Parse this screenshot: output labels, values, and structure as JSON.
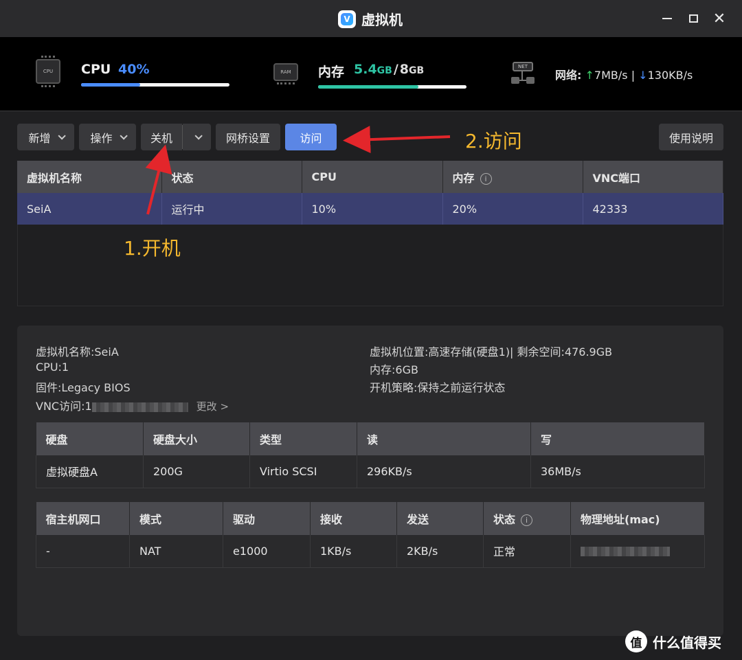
{
  "window": {
    "title": "虚拟机",
    "logo_letter": "V",
    "min_label": "",
    "close_label": "✕"
  },
  "monitor": {
    "cpu": {
      "icon": "CPU",
      "label": "CPU",
      "value": "40%",
      "percent": 40,
      "color": "#4a8dff"
    },
    "ram": {
      "icon": "RAM",
      "label": "内存",
      "used": "5.4",
      "used_unit": "GB",
      "sep": "/",
      "total": "8",
      "total_unit": "GB",
      "percent": 67.5,
      "color": "#2ec4a4"
    },
    "net": {
      "icon": "NET",
      "label": "网络:",
      "up_arrow": "↑",
      "up": "7MB/s",
      "sep": "|",
      "down_arrow": "↓",
      "down": "130KB/s"
    }
  },
  "toolbar": {
    "add": "新增",
    "action": "操作",
    "shutdown": "关机",
    "bridge": "网桥设置",
    "access": "访问",
    "help": "使用说明"
  },
  "vm_table": {
    "headers": [
      "虚拟机名称",
      "状态",
      "CPU",
      "内存",
      "VNC端口"
    ],
    "info_icon": "i",
    "rows": [
      [
        "SeiA",
        "运行中",
        "10%",
        "20%",
        "42333"
      ]
    ]
  },
  "annotations": {
    "a1": "1.开机",
    "a2": "2.访问"
  },
  "detail": {
    "name": "虚拟机名称:SeiA",
    "cpu": "CPU:1",
    "firmware": "固件:Legacy BIOS",
    "vnc_label": "VNC访问:1",
    "vnc_change": "更改 >",
    "location": "虚拟机位置:高速存储(硬盘1)| 剩余空间:476.9GB",
    "memory": "内存:6GB",
    "boot_policy": "开机策略:保持之前运行状态"
  },
  "disk_table": {
    "headers": [
      "硬盘",
      "硬盘大小",
      "类型",
      "读",
      "写"
    ],
    "rows": [
      [
        "虚拟硬盘A",
        "200G",
        "Virtio SCSI",
        "296KB/s",
        "36MB/s"
      ]
    ]
  },
  "nic_table": {
    "headers": [
      "宿主机网口",
      "模式",
      "驱动",
      "接收",
      "发送",
      "状态",
      "物理地址(mac)"
    ],
    "rows": [
      [
        "-",
        "NAT",
        "e1000",
        "1KB/s",
        "2KB/s",
        "正常",
        ""
      ]
    ]
  },
  "watermark": {
    "badge": "值",
    "text": "什么值得买"
  }
}
